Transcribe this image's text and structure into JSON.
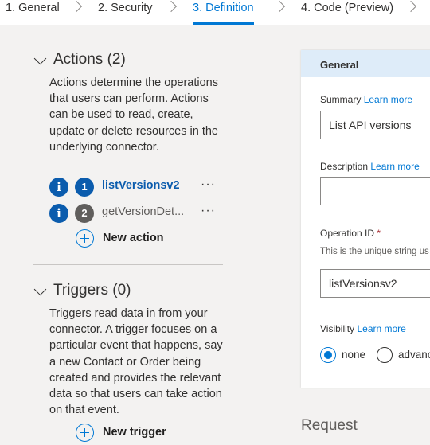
{
  "tabs": [
    {
      "label": "1. General"
    },
    {
      "label": "2. Security"
    },
    {
      "label": "3. Definition",
      "active": true
    },
    {
      "label": "4. Code (Preview)"
    }
  ],
  "actions": {
    "title": "Actions (2)",
    "description": "Actions determine the operations that users can perform. Actions can be used to read, create, update or delete resources in the underlying connector.",
    "items": [
      {
        "number": "1",
        "name": "listVersionsv2",
        "selected": true,
        "more": "···",
        "info": "i"
      },
      {
        "number": "2",
        "name": "getVersionDet...",
        "selected": false,
        "more": "···",
        "info": "i"
      }
    ],
    "new_label": "New action"
  },
  "triggers": {
    "title": "Triggers (0)",
    "description": "Triggers read data in from your connector. A trigger focuses on a particular event that happens, say a new Contact or Order being created and provides the relevant data so that users can take action on that event.",
    "new_label": "New trigger"
  },
  "general": {
    "header": "General",
    "summary_label": "Summary",
    "summary_link": "Learn more",
    "summary_value": "List API versions",
    "description_label": "Description",
    "description_link": "Learn more",
    "description_value": "",
    "operation_id_label": "Operation ID",
    "operation_id_required": "*",
    "operation_id_hint": "This is the unique string us",
    "operation_id_value": "listVersionsv2",
    "visibility_label": "Visibility",
    "visibility_link": "Learn more",
    "visibility_options": [
      {
        "label": "none",
        "selected": true
      },
      {
        "label": "advanc",
        "selected": false
      }
    ]
  },
  "request": {
    "title": "Request"
  },
  "colors": {
    "accent": "#0078d4",
    "selected_badge": "#0b5cad",
    "unselected_badge": "#605e5c",
    "card_header": "#deecf9"
  }
}
